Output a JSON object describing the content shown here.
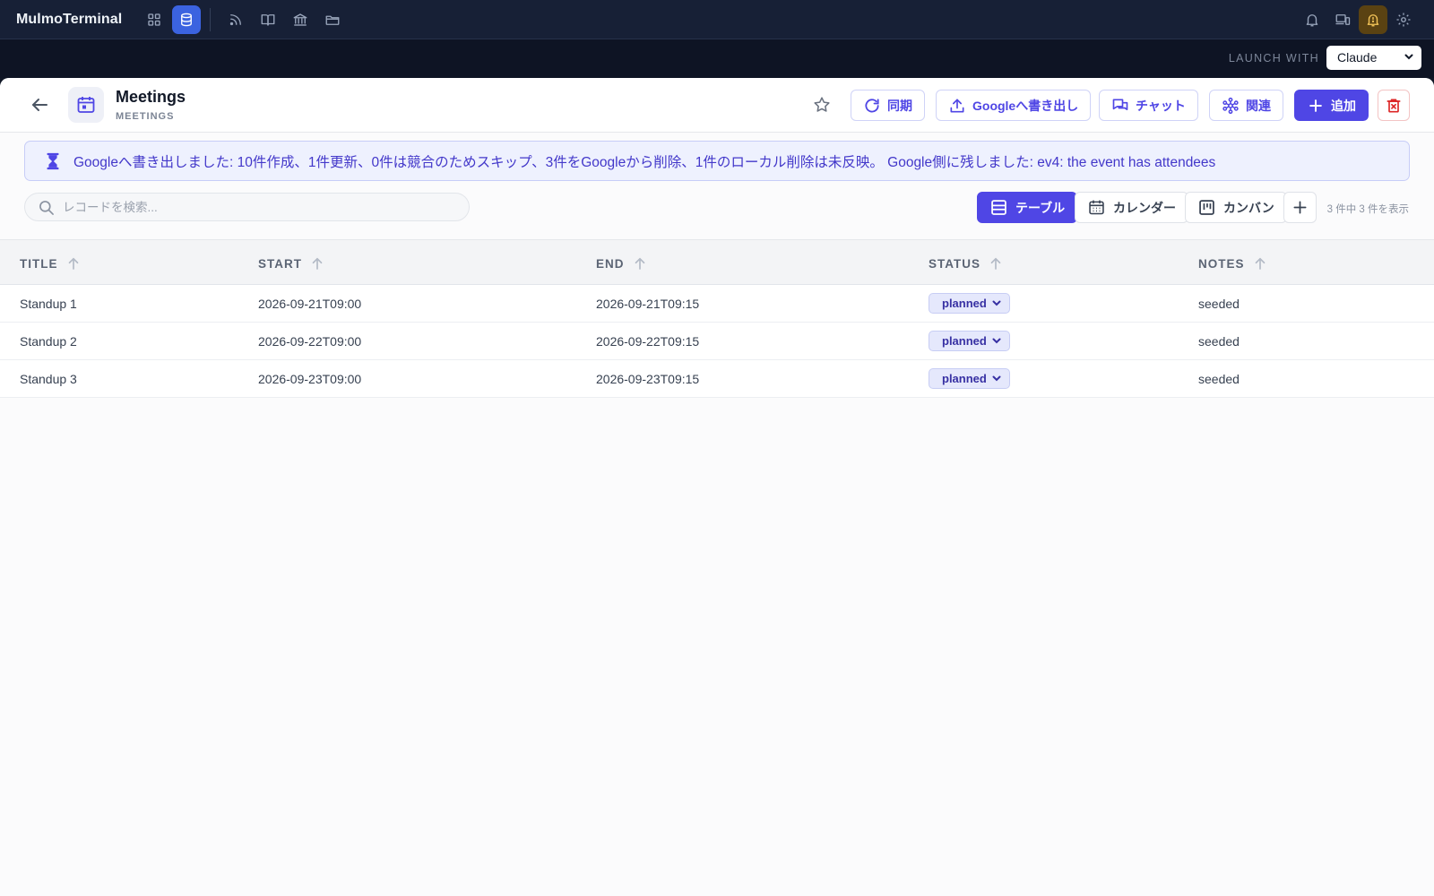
{
  "app": {
    "title": "MulmoTerminal"
  },
  "launch": {
    "label": "LAUNCH WITH",
    "selected": "Claude"
  },
  "database": {
    "title": "Meetings",
    "subtitle": "MEETINGS"
  },
  "actions": {
    "sync": "同期",
    "export_google": "Googleへ書き出し",
    "chat": "チャット",
    "related": "関連",
    "add": "追加"
  },
  "banner": {
    "text": "Googleへ書き出しました: 10件作成、1件更新、0件は競合のためスキップ、3件をGoogleから削除、1件のローカル削除は未反映。 Google側に残しました: ev4: the event has attendees"
  },
  "search": {
    "placeholder": "レコードを検索..."
  },
  "views": {
    "table": "テーブル",
    "calendar": "カレンダー",
    "kanban": "カンバン"
  },
  "record_count": "3 件中 3 件を表示",
  "table": {
    "columns": [
      "TITLE",
      "START",
      "END",
      "STATUS",
      "NOTES"
    ],
    "rows": [
      {
        "title": "Standup 1",
        "start": "2026-09-21T09:00",
        "end": "2026-09-21T09:15",
        "status": "planned",
        "notes": "seeded"
      },
      {
        "title": "Standup 2",
        "start": "2026-09-22T09:00",
        "end": "2026-09-22T09:15",
        "status": "planned",
        "notes": "seeded"
      },
      {
        "title": "Standup 3",
        "start": "2026-09-23T09:00",
        "end": "2026-09-23T09:15",
        "status": "planned",
        "notes": "seeded"
      }
    ]
  },
  "icons": {
    "topbar_left": [
      "grid-icon",
      "database-icon",
      "rss-icon",
      "book-icon",
      "bank-icon",
      "folder-icon"
    ],
    "topbar_right": [
      "bell-icon",
      "devices-icon",
      "bell-alert-icon",
      "gear-icon"
    ]
  },
  "colors": {
    "accent": "#4f46e5",
    "topbar": "#172036",
    "active_icon": "#3b63e0",
    "danger": "#dc2626"
  }
}
